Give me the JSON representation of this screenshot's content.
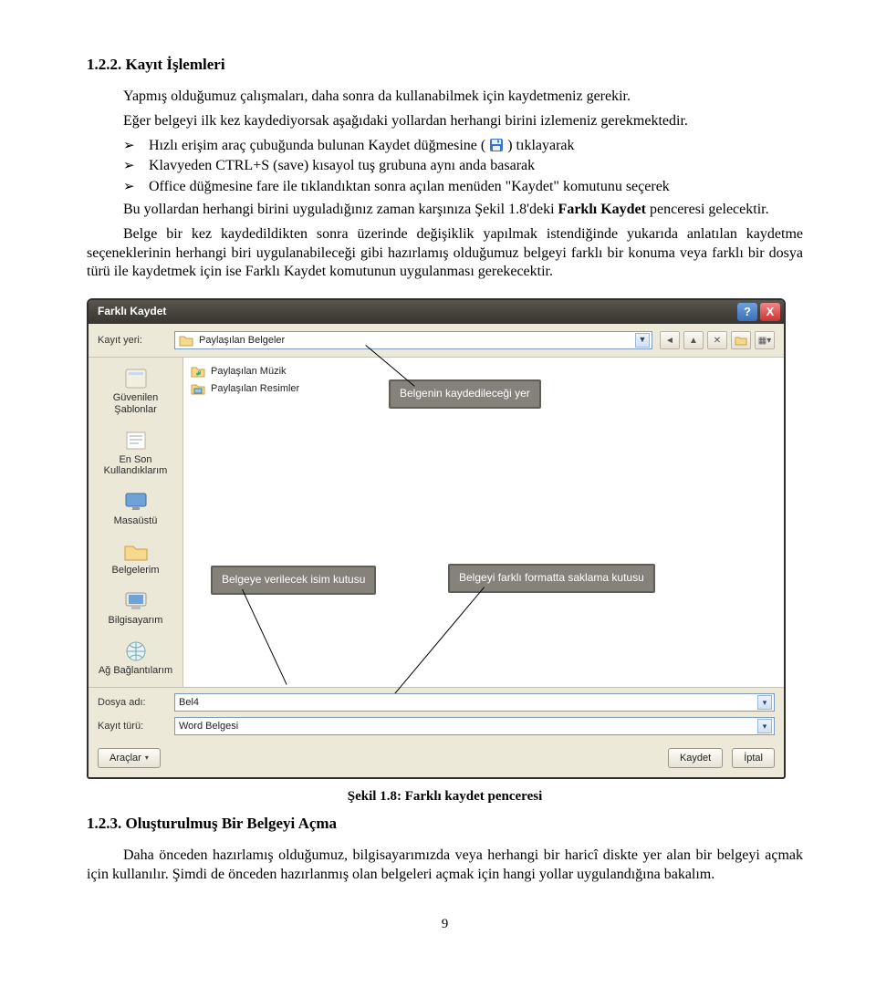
{
  "doc": {
    "section1_heading": "1.2.2. Kayıt İşlemleri",
    "p1": "Yapmış olduğumuz çalışmaları, daha sonra da kullanabilmek için kaydetmeniz gerekir.",
    "p2": "Eğer belgeyi ilk kez kaydediyorsak aşağıdaki yollardan herhangi birini izlemeniz gerekmektedir.",
    "bullets": [
      "Hızlı erişim araç çubuğunda bulunan Kaydet düğmesine (",
      ") tıklayarak",
      "Klavyeden CTRL+S (save) kısayol tuş grubuna aynı anda basarak",
      "Office düğmesine fare ile tıklandıktan sonra açılan menüden \"Kaydet\" komutunu seçerek"
    ],
    "p3a": "Bu yollardan herhangi birini uyguladığınız zaman karşınıza Şekil 1.8'deki ",
    "p3b": "Farklı Kaydet",
    "p3c": " penceresi gelecektir.",
    "p4": "Belge bir kez kaydedildikten sonra üzerinde değişiklik yapılmak istendiğinde yukarıda anlatılan kaydetme seçeneklerinin herhangi biri uygulanabileceği gibi hazırlamış olduğumuz belgeyi farklı bir konuma veya farklı bir dosya türü ile kaydetmek için ise Farklı Kaydet komutunun uygulanması gerekecektir.",
    "caption": "Şekil 1.8: Farklı kaydet penceresi",
    "section2_heading": "1.2.3. Oluşturulmuş Bir Belgeyi Açma",
    "p5": "Daha önceden hazırlamış olduğumuz, bilgisayarımızda veya herhangi bir haricî diskte yer alan bir belgeyi açmak için kullanılır. Şimdi de önceden hazırlanmış olan belgeleri açmak için hangi yollar uygulandığına bakalım.",
    "page_number": "9"
  },
  "dialog": {
    "title": "Farklı Kaydet",
    "help": "?",
    "close": "X",
    "save_in_label": "Kayıt yeri:",
    "save_in_value": "Paylaşılan Belgeler",
    "places": [
      "Güvenilen Şablonlar",
      "En Son Kullandıklarım",
      "Masaüstü",
      "Belgelerim",
      "Bilgisayarım",
      "Ağ Bağlantılarım"
    ],
    "files": [
      "Paylaşılan Müzik",
      "Paylaşılan Resimler"
    ],
    "callout_location": "Belgenin kaydedileceği yer",
    "callout_name": "Belgeye verilecek isim kutusu",
    "callout_type": "Belgeyi farklı formatta saklama kutusu",
    "filename_label": "Dosya adı:",
    "filename_value": "Bel4",
    "filetype_label": "Kayıt türü:",
    "filetype_value": "Word Belgesi",
    "tools": "Araçlar",
    "save": "Kaydet",
    "cancel": "İptal"
  }
}
